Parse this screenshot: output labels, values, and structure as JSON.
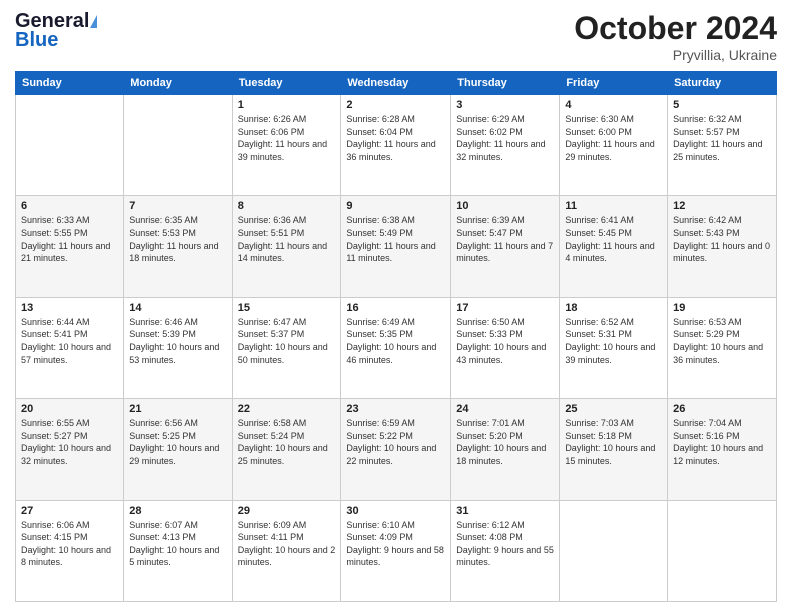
{
  "header": {
    "logo_general": "General",
    "logo_blue": "Blue",
    "month_title": "October 2024",
    "location": "Pryvillia, Ukraine"
  },
  "weekdays": [
    "Sunday",
    "Monday",
    "Tuesday",
    "Wednesday",
    "Thursday",
    "Friday",
    "Saturday"
  ],
  "weeks": [
    [
      {
        "day": "",
        "sunrise": "",
        "sunset": "",
        "daylight": ""
      },
      {
        "day": "",
        "sunrise": "",
        "sunset": "",
        "daylight": ""
      },
      {
        "day": "1",
        "sunrise": "Sunrise: 6:26 AM",
        "sunset": "Sunset: 6:06 PM",
        "daylight": "Daylight: 11 hours and 39 minutes."
      },
      {
        "day": "2",
        "sunrise": "Sunrise: 6:28 AM",
        "sunset": "Sunset: 6:04 PM",
        "daylight": "Daylight: 11 hours and 36 minutes."
      },
      {
        "day": "3",
        "sunrise": "Sunrise: 6:29 AM",
        "sunset": "Sunset: 6:02 PM",
        "daylight": "Daylight: 11 hours and 32 minutes."
      },
      {
        "day": "4",
        "sunrise": "Sunrise: 6:30 AM",
        "sunset": "Sunset: 6:00 PM",
        "daylight": "Daylight: 11 hours and 29 minutes."
      },
      {
        "day": "5",
        "sunrise": "Sunrise: 6:32 AM",
        "sunset": "Sunset: 5:57 PM",
        "daylight": "Daylight: 11 hours and 25 minutes."
      }
    ],
    [
      {
        "day": "6",
        "sunrise": "Sunrise: 6:33 AM",
        "sunset": "Sunset: 5:55 PM",
        "daylight": "Daylight: 11 hours and 21 minutes."
      },
      {
        "day": "7",
        "sunrise": "Sunrise: 6:35 AM",
        "sunset": "Sunset: 5:53 PM",
        "daylight": "Daylight: 11 hours and 18 minutes."
      },
      {
        "day": "8",
        "sunrise": "Sunrise: 6:36 AM",
        "sunset": "Sunset: 5:51 PM",
        "daylight": "Daylight: 11 hours and 14 minutes."
      },
      {
        "day": "9",
        "sunrise": "Sunrise: 6:38 AM",
        "sunset": "Sunset: 5:49 PM",
        "daylight": "Daylight: 11 hours and 11 minutes."
      },
      {
        "day": "10",
        "sunrise": "Sunrise: 6:39 AM",
        "sunset": "Sunset: 5:47 PM",
        "daylight": "Daylight: 11 hours and 7 minutes."
      },
      {
        "day": "11",
        "sunrise": "Sunrise: 6:41 AM",
        "sunset": "Sunset: 5:45 PM",
        "daylight": "Daylight: 11 hours and 4 minutes."
      },
      {
        "day": "12",
        "sunrise": "Sunrise: 6:42 AM",
        "sunset": "Sunset: 5:43 PM",
        "daylight": "Daylight: 11 hours and 0 minutes."
      }
    ],
    [
      {
        "day": "13",
        "sunrise": "Sunrise: 6:44 AM",
        "sunset": "Sunset: 5:41 PM",
        "daylight": "Daylight: 10 hours and 57 minutes."
      },
      {
        "day": "14",
        "sunrise": "Sunrise: 6:46 AM",
        "sunset": "Sunset: 5:39 PM",
        "daylight": "Daylight: 10 hours and 53 minutes."
      },
      {
        "day": "15",
        "sunrise": "Sunrise: 6:47 AM",
        "sunset": "Sunset: 5:37 PM",
        "daylight": "Daylight: 10 hours and 50 minutes."
      },
      {
        "day": "16",
        "sunrise": "Sunrise: 6:49 AM",
        "sunset": "Sunset: 5:35 PM",
        "daylight": "Daylight: 10 hours and 46 minutes."
      },
      {
        "day": "17",
        "sunrise": "Sunrise: 6:50 AM",
        "sunset": "Sunset: 5:33 PM",
        "daylight": "Daylight: 10 hours and 43 minutes."
      },
      {
        "day": "18",
        "sunrise": "Sunrise: 6:52 AM",
        "sunset": "Sunset: 5:31 PM",
        "daylight": "Daylight: 10 hours and 39 minutes."
      },
      {
        "day": "19",
        "sunrise": "Sunrise: 6:53 AM",
        "sunset": "Sunset: 5:29 PM",
        "daylight": "Daylight: 10 hours and 36 minutes."
      }
    ],
    [
      {
        "day": "20",
        "sunrise": "Sunrise: 6:55 AM",
        "sunset": "Sunset: 5:27 PM",
        "daylight": "Daylight: 10 hours and 32 minutes."
      },
      {
        "day": "21",
        "sunrise": "Sunrise: 6:56 AM",
        "sunset": "Sunset: 5:25 PM",
        "daylight": "Daylight: 10 hours and 29 minutes."
      },
      {
        "day": "22",
        "sunrise": "Sunrise: 6:58 AM",
        "sunset": "Sunset: 5:24 PM",
        "daylight": "Daylight: 10 hours and 25 minutes."
      },
      {
        "day": "23",
        "sunrise": "Sunrise: 6:59 AM",
        "sunset": "Sunset: 5:22 PM",
        "daylight": "Daylight: 10 hours and 22 minutes."
      },
      {
        "day": "24",
        "sunrise": "Sunrise: 7:01 AM",
        "sunset": "Sunset: 5:20 PM",
        "daylight": "Daylight: 10 hours and 18 minutes."
      },
      {
        "day": "25",
        "sunrise": "Sunrise: 7:03 AM",
        "sunset": "Sunset: 5:18 PM",
        "daylight": "Daylight: 10 hours and 15 minutes."
      },
      {
        "day": "26",
        "sunrise": "Sunrise: 7:04 AM",
        "sunset": "Sunset: 5:16 PM",
        "daylight": "Daylight: 10 hours and 12 minutes."
      }
    ],
    [
      {
        "day": "27",
        "sunrise": "Sunrise: 6:06 AM",
        "sunset": "Sunset: 4:15 PM",
        "daylight": "Daylight: 10 hours and 8 minutes."
      },
      {
        "day": "28",
        "sunrise": "Sunrise: 6:07 AM",
        "sunset": "Sunset: 4:13 PM",
        "daylight": "Daylight: 10 hours and 5 minutes."
      },
      {
        "day": "29",
        "sunrise": "Sunrise: 6:09 AM",
        "sunset": "Sunset: 4:11 PM",
        "daylight": "Daylight: 10 hours and 2 minutes."
      },
      {
        "day": "30",
        "sunrise": "Sunrise: 6:10 AM",
        "sunset": "Sunset: 4:09 PM",
        "daylight": "Daylight: 9 hours and 58 minutes."
      },
      {
        "day": "31",
        "sunrise": "Sunrise: 6:12 AM",
        "sunset": "Sunset: 4:08 PM",
        "daylight": "Daylight: 9 hours and 55 minutes."
      },
      {
        "day": "",
        "sunrise": "",
        "sunset": "",
        "daylight": ""
      },
      {
        "day": "",
        "sunrise": "",
        "sunset": "",
        "daylight": ""
      }
    ]
  ]
}
